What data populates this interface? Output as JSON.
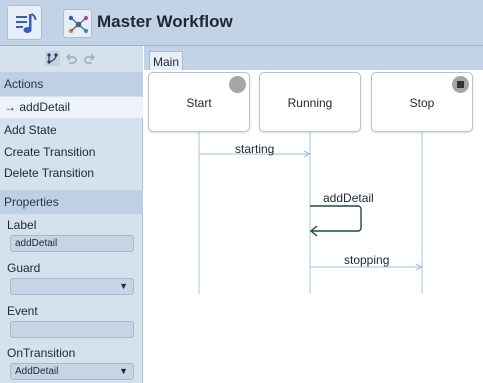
{
  "header": {
    "title": "Master Workflow"
  },
  "sidebar": {
    "actions_header": "Actions",
    "actions": [
      {
        "label": "addDetail",
        "arrow": "→",
        "selected": true
      },
      {
        "label": "Add State"
      },
      {
        "label": "Create Transition"
      },
      {
        "label": "Delete Transition"
      }
    ],
    "properties_header": "Properties",
    "properties": {
      "label_label": "Label",
      "label_value": "addDetail",
      "guard_label": "Guard",
      "guard_value": "",
      "event_label": "Event",
      "event_value": "",
      "ontransition_label": "OnTransition",
      "ontransition_value": "AddDetail"
    }
  },
  "main": {
    "tab": "Main",
    "states": [
      {
        "name": "Start",
        "marker": "circle"
      },
      {
        "name": "Running",
        "marker": "none"
      },
      {
        "name": "Stop",
        "marker": "stop"
      }
    ],
    "transitions": [
      {
        "label": "starting",
        "from": "Start",
        "to": "Running"
      },
      {
        "label": "addDetail",
        "from": "Running",
        "to": "Running"
      },
      {
        "label": "stopping",
        "from": "Running",
        "to": "Stop"
      }
    ]
  },
  "colors": {
    "header": "#c3d3e6",
    "sidebar": "#d6e1ee",
    "lifeline": "#a9c7e0",
    "self_arrow": "#1d4a44"
  }
}
